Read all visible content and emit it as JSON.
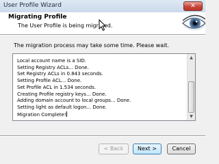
{
  "window": {
    "title": "User Profile Wizard",
    "close_label": "✕"
  },
  "header": {
    "title": "Migrating Profile",
    "subtitle": "The User Profile is being migrated."
  },
  "main": {
    "message": "The migration process may take some time. Please wait.",
    "log_lines": [
      "Local account name is a SID.",
      "Setting Registry ACLs... Done.",
      "Set Registry ACLs in 0.843 seconds.",
      "Setting Profile ACL... Done.",
      "Set Profile ACL in 1.534 seconds.",
      "Creating Profile registry keys... Done.",
      "Adding domain account to local groups... Done.",
      "Setting light as default logon... Done.",
      "Migration Complete!"
    ]
  },
  "buttons": {
    "back": "< Back",
    "next": "Next >",
    "cancel": "Cancel"
  },
  "icons": {
    "logo": "eye-logo-icon",
    "cursor": "mouse-cursor-icon",
    "scroll_up": "scroll-up-arrow-icon",
    "scroll_down": "scroll-down-arrow-icon"
  },
  "colors": {
    "titlebar": "#cbd9ea",
    "close_button": "#c7453a",
    "header_background": "#ffffff",
    "next_button_border": "#3c7fb1"
  }
}
